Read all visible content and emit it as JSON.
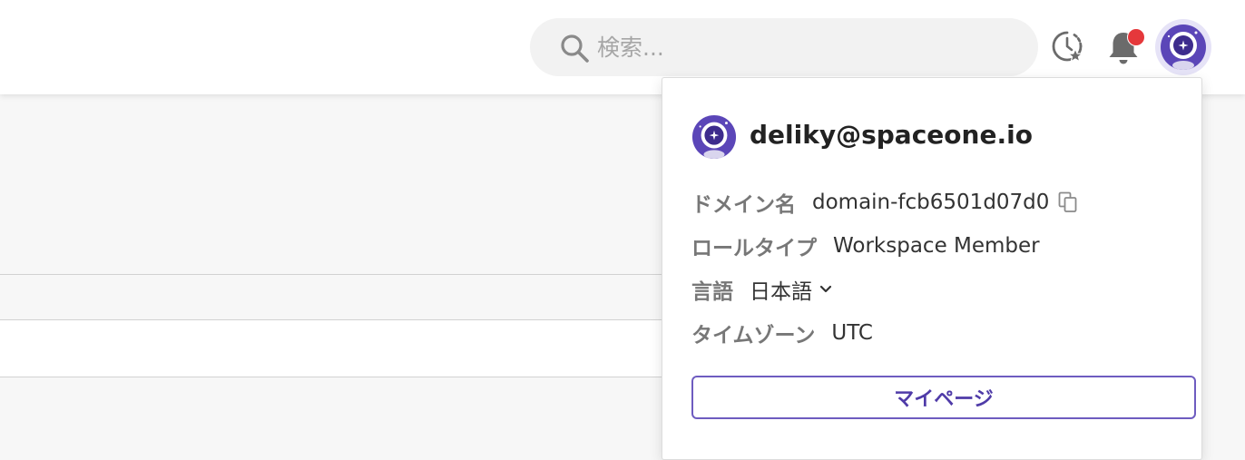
{
  "header": {
    "search": {
      "placeholder": "検索...",
      "value": ""
    },
    "icons": {
      "search": "search-icon",
      "recent": "recent-favorites-icon",
      "notifications": "bell-icon",
      "avatar": "user-avatar-icon"
    },
    "notification_badge_color": "#e5383b"
  },
  "profile_menu": {
    "email": "deliky@spaceone.io",
    "rows": {
      "domain": {
        "label": "ドメイン名",
        "value": "domain-fcb6501d07d0"
      },
      "role": {
        "label": "ロールタイプ",
        "value": "Workspace Member"
      },
      "language": {
        "label": "言語",
        "value": "日本語"
      },
      "timezone": {
        "label": "タイムゾーン",
        "value": "UTC"
      }
    },
    "mypage_button": "マイページ"
  },
  "colors": {
    "accent": "#5b46b8",
    "accent_light": "#e6e3f7"
  }
}
